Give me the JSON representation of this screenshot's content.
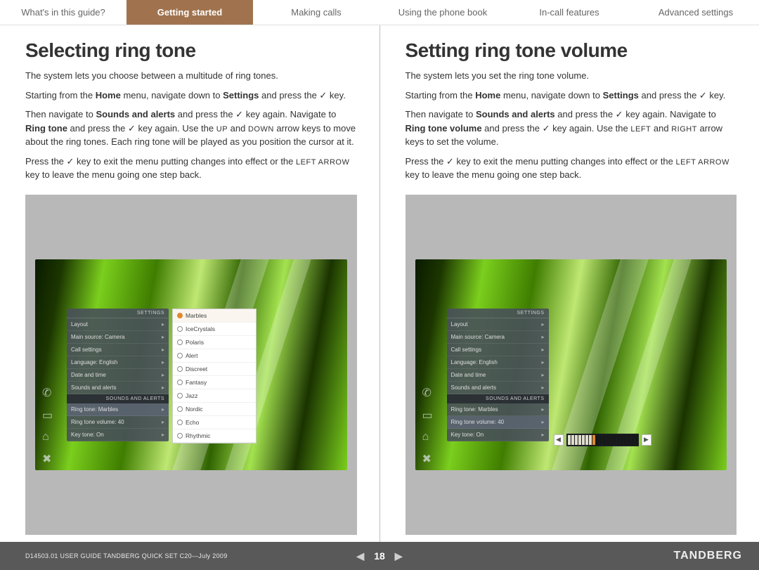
{
  "nav": {
    "items": [
      {
        "label": "What's in this guide?",
        "active": false
      },
      {
        "label": "Getting started",
        "active": true
      },
      {
        "label": "Making calls",
        "active": false
      },
      {
        "label": "Using the phone book",
        "active": false
      },
      {
        "label": "In-call features",
        "active": false
      },
      {
        "label": "Advanced settings",
        "active": false
      }
    ]
  },
  "left": {
    "title": "Selecting ring tone",
    "p1": "The system lets you choose between a multitude of ring tones.",
    "p2a": "Starting from the ",
    "p2b": "Home",
    "p2c": " menu, navigate down to ",
    "p2d": "Settings",
    "p2e": " and press the ",
    "p2f": " key.",
    "p3a": "Then navigate to ",
    "p3b": "Sounds and alerts",
    "p3c": " and press the ",
    "p3d": " key again. Navigate to ",
    "p3e": "Ring tone",
    "p3f": " and press the ",
    "p3g": " key again. Use the ",
    "p3h": "UP",
    "p3i": " and ",
    "p3j": "DOWN",
    "p3k": " arrow keys to move about the ring tones. Each ring tone will be played as you position the cursor at it.",
    "p4a": "Press the ",
    "p4b": " key to exit the menu putting changes into effect or the ",
    "p4c": "LEFT ARROW",
    "p4d": " key to leave the menu going one step back.",
    "menu": {
      "header": "SETTINGS",
      "rows": [
        "Layout",
        "Main source: Camera",
        "Call settings",
        "Language: English",
        "Date and time",
        "Sounds and alerts"
      ],
      "subheader": "SOUNDS AND ALERTS",
      "subrows": [
        "Ring tone: Marbles",
        "Ring tone volume: 40",
        "Key tone: On"
      ],
      "options": [
        "Marbles",
        "IceCrystals",
        "Polaris",
        "Alert",
        "Discreet",
        "Fantasy",
        "Jazz",
        "Nordic",
        "Echo",
        "Rhythmic"
      ]
    }
  },
  "right": {
    "title": "Setting ring tone volume",
    "p1": "The system lets you set the ring tone volume.",
    "p2a": "Starting from the ",
    "p2b": "Home",
    "p2c": " menu, navigate down to ",
    "p2d": "Settings",
    "p2e": " and press the ",
    "p2f": " key.",
    "p3a": "Then navigate to ",
    "p3b": "Sounds and alerts",
    "p3c": " and press the ",
    "p3d": " key again. Navigate to ",
    "p3e": "Ring tone volume",
    "p3f": " and press the ",
    "p3g": " key again. Use the ",
    "p3h": "LEFT",
    "p3i": " and ",
    "p3j": "RIGHT",
    "p3k": " arrow keys to set the volume.",
    "p4a": "Press the ",
    "p4b": " key to exit the menu putting changes into effect or the ",
    "p4c": "LEFT ARROW",
    "p4d": " key to leave the menu going one step back.",
    "menu": {
      "header": "SETTINGS",
      "rows": [
        "Layout",
        "Main source: Camera",
        "Call settings",
        "Language: English",
        "Date and time",
        "Sounds and alerts"
      ],
      "subheader": "SOUNDS AND ALERTS",
      "subrows": [
        "Ring tone: Marbles",
        "Ring tone volume: 40",
        "Key tone: On"
      ]
    }
  },
  "footer": {
    "docid": "D14503.01 USER GUIDE TANDBERG QUICK SET C20—July 2009",
    "page": "18",
    "brand": "TANDBERG"
  },
  "glyphs": {
    "check": "✓",
    "chev_r": "▸",
    "tri_l": "◀",
    "tri_r": "▶"
  }
}
